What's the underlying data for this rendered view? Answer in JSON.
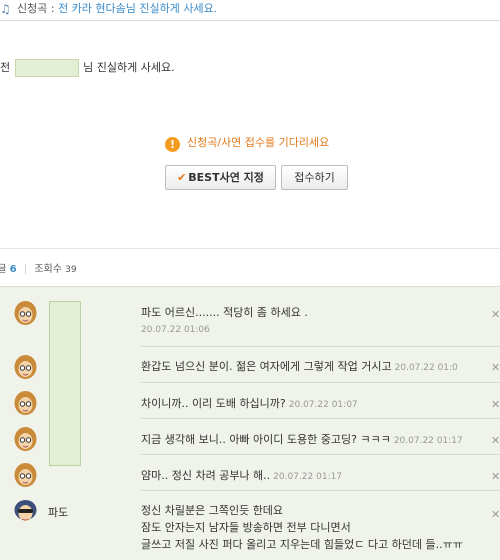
{
  "header": {
    "label": "신청곡 :",
    "message": "전 카라 현다솜님 진실하게 사세요."
  },
  "post": {
    "pre": "전",
    "post": "님 진실하게 사세요."
  },
  "notice": "신청곡/사연 접수를 기다리세요",
  "buttons": {
    "best": "BEST사연 지정",
    "apply": "접수하기"
  },
  "counts": {
    "comment_label": "댓글",
    "comment_count": "6",
    "view_label": "조회수",
    "view_count": "39"
  },
  "comments": [
    {
      "text": "파도 어르신....... 적당히 좀 하세요 .",
      "date": "20.07.22 01:06"
    },
    {
      "text": "환갑도 넘으신 분이. 젊은 여자에게 그렇게 작업 거시고",
      "date": "20.07.22 01:0"
    },
    {
      "text": "차이니까.. 이리 도배 하십니까?",
      "date": "20.07.22 01:07"
    },
    {
      "text": "지금 생각해 보니.. 아빠 아이디 도용한 중고딩? ㅋㅋㅋ",
      "date": "20.07.22 01:17"
    },
    {
      "text": "얌마.. 정신 차려 공부나 해..",
      "date": "20.07.22 01:17"
    }
  ],
  "last_comment": {
    "author": "파도",
    "lines": [
      "정신 차릴분은 그쪽인듯 한데요",
      "잠도 안자는지 남자들 방송하면 전부 다니면서",
      "글쓰고 저질 사진 퍼다 올리고 지우는데 힘들었ㄷ 다고 하던데 들..ㅠㅠ"
    ]
  },
  "colors": {
    "accent": "#3a8bc8",
    "notice": "#e07a1c",
    "list_bg": "#eff3ea"
  }
}
